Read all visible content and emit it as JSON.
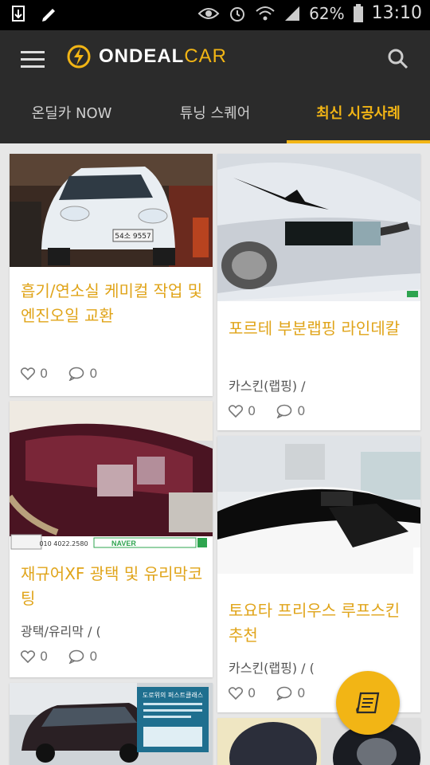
{
  "status": {
    "battery": "62%",
    "time": "13:10"
  },
  "app": {
    "brand": "ONDEAL",
    "brand_suffix": "CAR"
  },
  "tabs": [
    {
      "label": "온딜카 NOW"
    },
    {
      "label": "튜닝 스퀘어"
    },
    {
      "label": "최신 시공사례"
    }
  ],
  "posts": [
    {
      "title": "흡기/연소실 케미컬 작업 및 엔진오일 교환",
      "category": "",
      "likes": "0",
      "comments": "0"
    },
    {
      "title": "포르테 부분랩핑 라인데칼",
      "category": "카스킨(랩핑) /",
      "likes": "0",
      "comments": "0"
    },
    {
      "title": "재규어XF 광택 및 유리막코팅",
      "category": "광택/유리막 / (",
      "likes": "0",
      "comments": "0"
    },
    {
      "title": "토요타 프리우스 루프스킨 추천",
      "category": "카스킨(랩핑) / (",
      "likes": "0",
      "comments": "0"
    },
    {
      "title": "",
      "category": "",
      "likes": "",
      "comments": ""
    },
    {
      "title": "",
      "category": "",
      "likes": "",
      "comments": ""
    }
  ],
  "image_text": {
    "plate": "54소 9557",
    "shop_phone": "010 4022.2580",
    "naver": "NAVER",
    "banner": "도로위의 퍼스트클래스"
  },
  "colors": {
    "accent": "#f2b515",
    "bar": "#2b2b2b"
  }
}
